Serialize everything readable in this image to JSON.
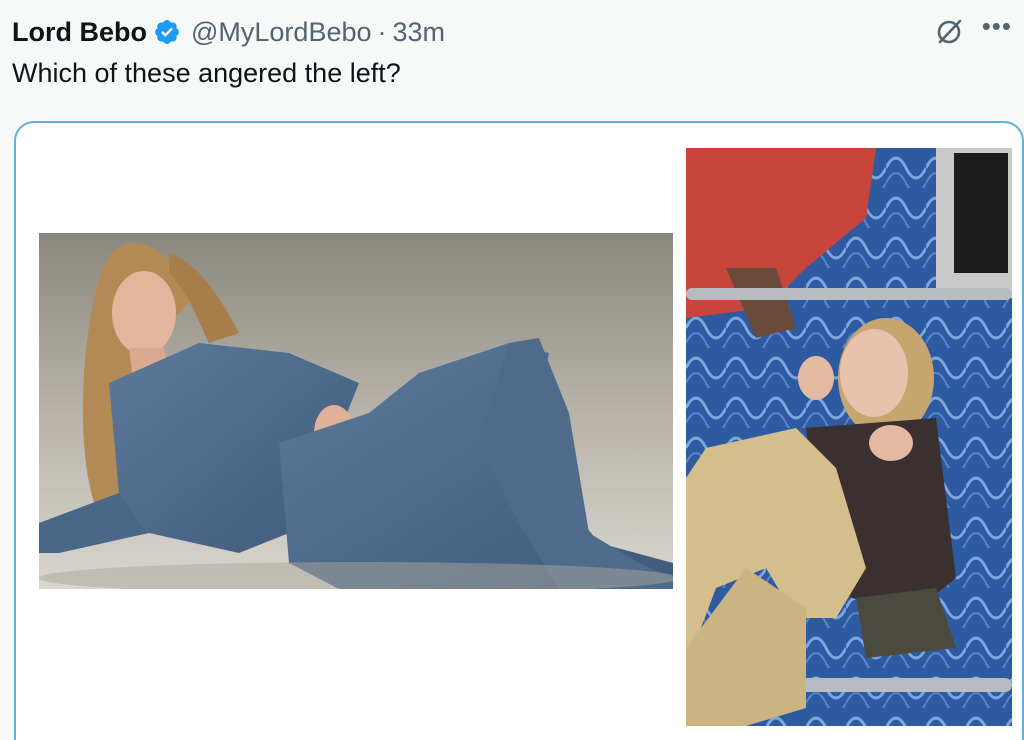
{
  "tweet": {
    "display_name": "Lord Bebo",
    "handle": "@MyLordBebo",
    "separator": "·",
    "time": "33m",
    "text": "Which of these angered the left?"
  },
  "icons": {
    "verified": "verified-badge-icon",
    "grok": "grok-icon",
    "more": "more-options-icon"
  },
  "colors": {
    "verified_blue": "#1d9bf0",
    "media_border": "#62b0d8",
    "secondary_text": "#536471"
  },
  "media": {
    "images": [
      {
        "description_name": "denim-photo"
      },
      {
        "description_name": "train-seat-photo"
      }
    ]
  }
}
